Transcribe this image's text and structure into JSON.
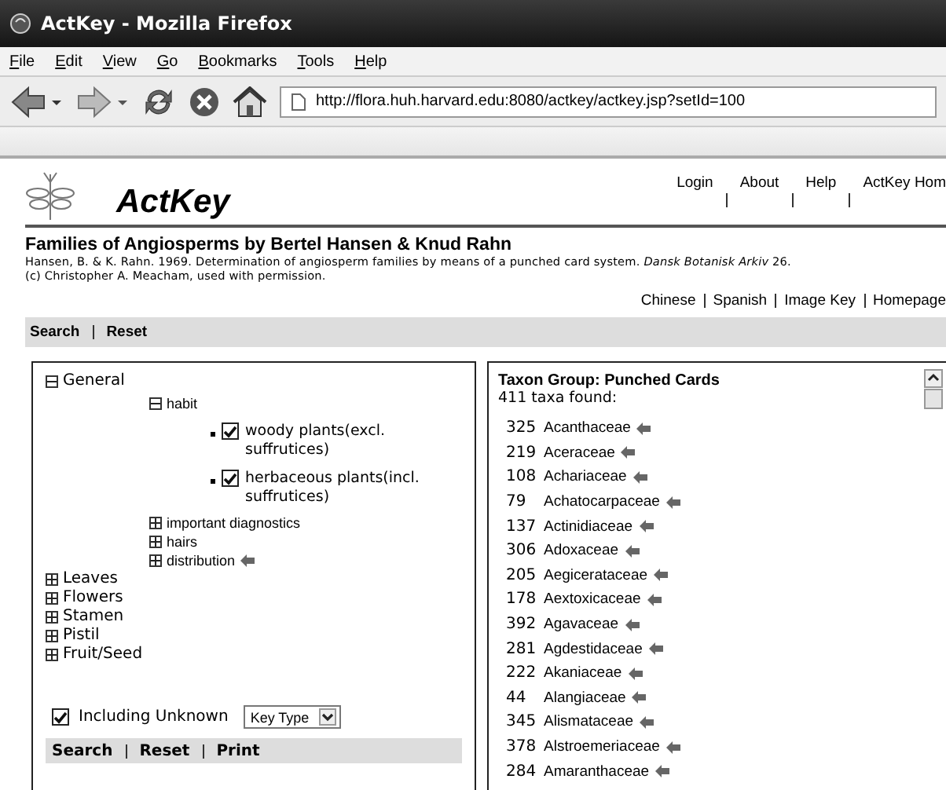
{
  "window": {
    "title": "ActKey - Mozilla Firefox"
  },
  "menu": [
    "File",
    "Edit",
    "View",
    "Go",
    "Bookmarks",
    "Tools",
    "Help"
  ],
  "address": "http://flora.huh.harvard.edu:8080/actkey/actkey.jsp?setId=100",
  "site": {
    "logo_text": "ActKey",
    "top_links": [
      "Login",
      "About",
      "Help",
      "ActKey Hom"
    ]
  },
  "heading": "Families of Angiosperms by Bertel Hansen & Knud Rahn",
  "citation": "Hansen, B. & K. Rahn. 1969. Determination of angiosperm families by means of a punched card system. *Dansk Botanisk Arkiv* 26.",
  "copyright": "(c) Christopher A. Meacham, used with permission.",
  "language_links": [
    "Chinese",
    "Spanish",
    "Image Key",
    "Homepage"
  ],
  "top_actions": [
    "Search",
    "Reset"
  ],
  "tree": [
    {
      "kind": "group",
      "label": "General",
      "expanded": true,
      "children": [
        {
          "kind": "subgroup",
          "label": "habit",
          "expanded": true,
          "children": [
            {
              "kind": "option",
              "label": "woody plants(excl. suffrutices)",
              "checked": true
            },
            {
              "kind": "option",
              "label": "herbaceous plants(incl. suffrutices)",
              "checked": true
            }
          ]
        },
        {
          "kind": "subgroup",
          "label": "important diagnostics",
          "expanded": false
        },
        {
          "kind": "subgroup",
          "label": "hairs",
          "expanded": false
        },
        {
          "kind": "subgroup",
          "label": "distribution",
          "expanded": false,
          "flagged": true
        }
      ]
    },
    {
      "kind": "group",
      "label": "Leaves",
      "expanded": false
    },
    {
      "kind": "group",
      "label": "Flowers",
      "expanded": false
    },
    {
      "kind": "group",
      "label": "Stamen",
      "expanded": false
    },
    {
      "kind": "group",
      "label": "Pistil",
      "expanded": false
    },
    {
      "kind": "group",
      "label": "Fruit/Seed",
      "expanded": false
    }
  ],
  "including_unknown": {
    "label": "Including Unknown",
    "checked": true
  },
  "key_type": {
    "value": "Key Type"
  },
  "bottom_actions": [
    "Search",
    "Reset",
    "Print"
  ],
  "results": {
    "title": "Taxon Group: Punched Cards",
    "count": "411 taxa found:",
    "taxa": [
      {
        "number": "325",
        "name": "Acanthaceae"
      },
      {
        "number": "219",
        "name": "Aceraceae"
      },
      {
        "number": "108",
        "name": "Achariaceae"
      },
      {
        "number": "79",
        "name": "Achatocarpaceae"
      },
      {
        "number": "137",
        "name": "Actinidiaceae"
      },
      {
        "number": "306",
        "name": "Adoxaceae"
      },
      {
        "number": "205",
        "name": "Aegicerataceae"
      },
      {
        "number": "178",
        "name": "Aextoxicaceae"
      },
      {
        "number": "392",
        "name": "Agavaceae"
      },
      {
        "number": "281",
        "name": "Agdestidaceae"
      },
      {
        "number": "222",
        "name": "Akaniaceae"
      },
      {
        "number": "44",
        "name": "Alangiaceae"
      },
      {
        "number": "345",
        "name": "Alismataceae"
      },
      {
        "number": "378",
        "name": "Alstroemeriaceae"
      },
      {
        "number": "284",
        "name": "Amaranthaceae"
      }
    ]
  }
}
